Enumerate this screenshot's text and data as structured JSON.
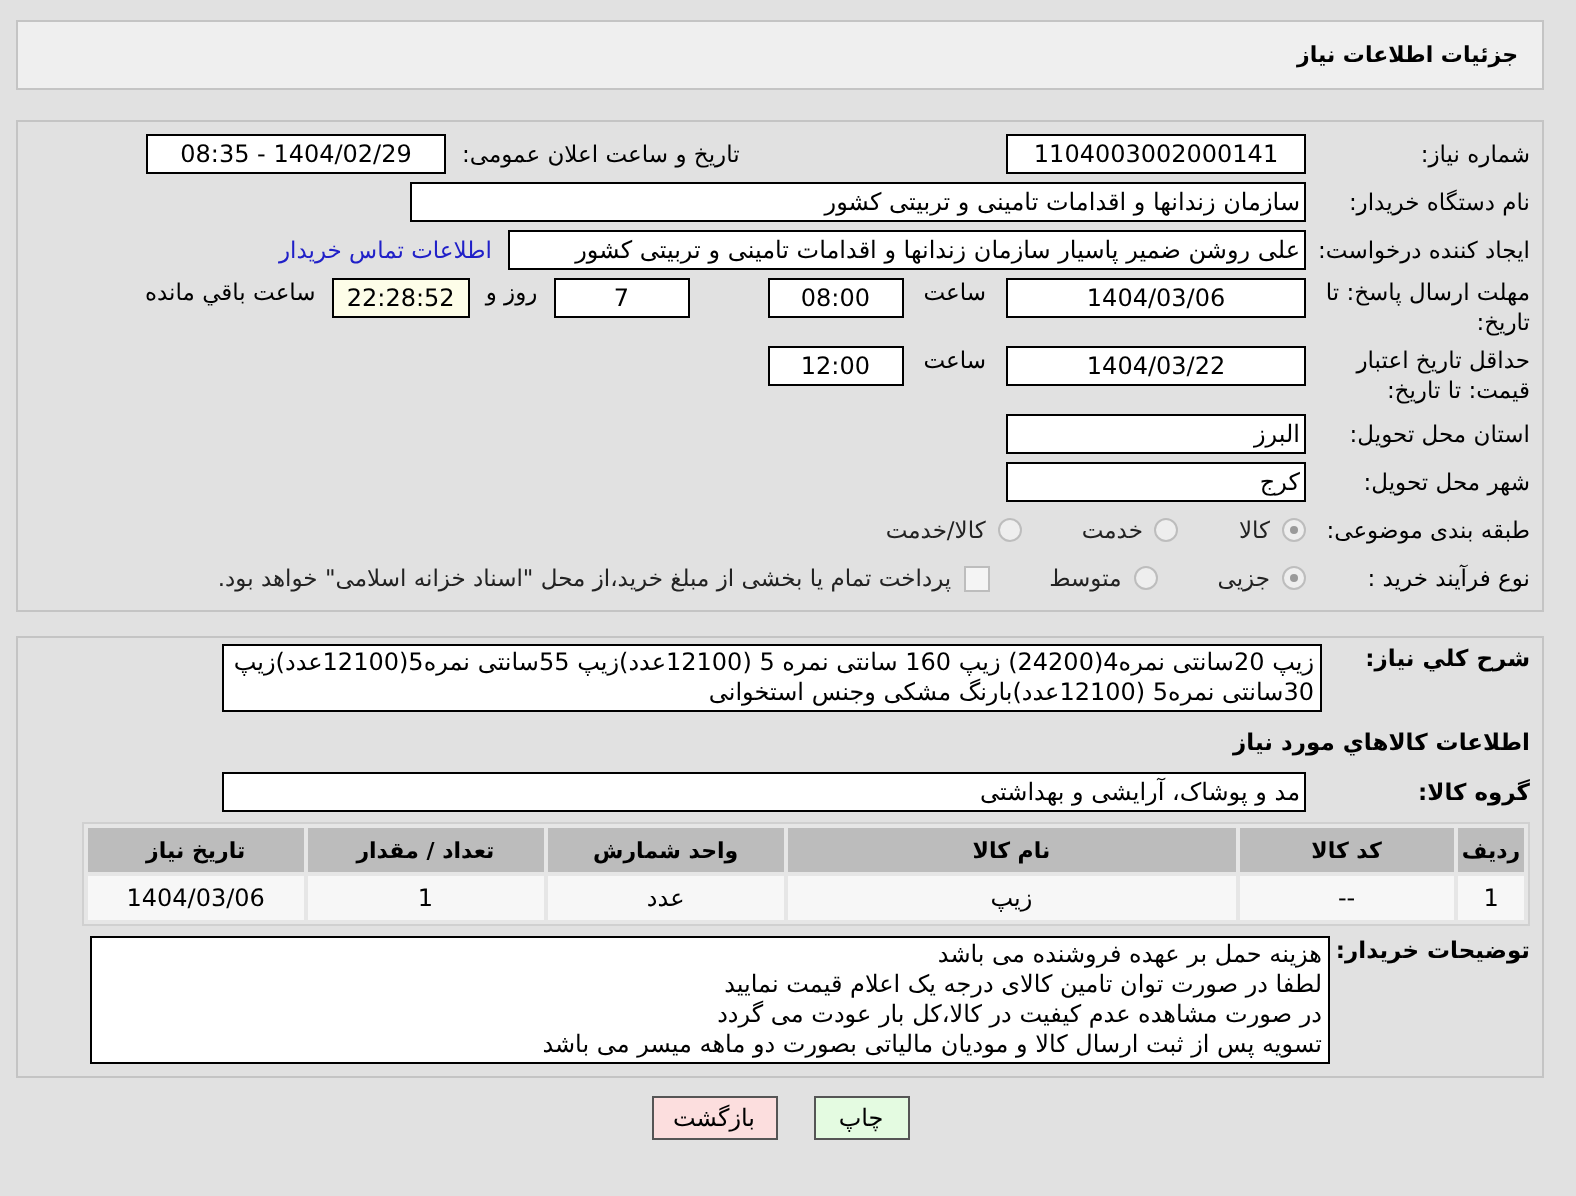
{
  "header": {
    "title": "جزئیات اطلاعات نیاز"
  },
  "need_number": {
    "label": "شماره نیاز:",
    "value": "1104003002000141"
  },
  "announce": {
    "label": "تاریخ و ساعت اعلان عمومی:",
    "value": "1404/02/29 - 08:35"
  },
  "buyer_org": {
    "label": "نام دستگاه خریدار:",
    "value": "سازمان زندانها و اقدامات تامینی و تربیتی کشور"
  },
  "requester": {
    "label": "ایجاد کننده درخواست:",
    "value": "علی روشن ضمیر پاسیار سازمان زندانها و اقدامات تامینی و تربیتی کشور",
    "link": "اطلاعات تماس خریدار"
  },
  "deadline": {
    "label": "مهلت ارسال پاسخ: تا تاریخ:",
    "date": "1404/03/06",
    "time_label": "ساعت",
    "time": "08:00",
    "days": "7",
    "days_label": "روز و",
    "remaining": "22:28:52",
    "remaining_label": "ساعت باقي مانده"
  },
  "validity": {
    "label": "حداقل تاریخ اعتبار قیمت: تا تاریخ:",
    "date": "1404/03/22",
    "time_label": "ساعت",
    "time": "12:00"
  },
  "province": {
    "label": "استان محل تحویل:",
    "value": "البرز"
  },
  "city": {
    "label": "شهر محل تحویل:",
    "value": "کرج"
  },
  "category": {
    "label": "طبقه بندی موضوعی:",
    "options": [
      {
        "label": "کالا",
        "selected": true
      },
      {
        "label": "خدمت",
        "selected": false
      },
      {
        "label": "کالا/خدمت",
        "selected": false
      }
    ]
  },
  "process": {
    "label": "نوع فرآیند خرید :",
    "options": [
      {
        "label": "جزیی",
        "selected": true
      },
      {
        "label": "متوسط",
        "selected": false
      }
    ],
    "treasury": {
      "label": "پرداخت تمام یا بخشی از مبلغ خرید،از محل \"اسناد خزانه اسلامی\" خواهد بود.",
      "checked": false
    }
  },
  "description": {
    "label": "شرح کلي نياز:",
    "value": "زیپ 20سانتی نمره4(24200) زیپ 160 سانتی نمره 5 (12100عدد)زیپ 55سانتی نمره5(12100عدد)زیپ 30سانتی نمره5 (12100عدد)بارنگ مشکی وجنس استخوانی"
  },
  "goods_heading": "اطلاعات کالاهاي مورد نياز",
  "goods_group": {
    "label": "گروه کالا:",
    "value": "مد و پوشاک، آرایشی و بهداشتی"
  },
  "table": {
    "columns": [
      "ردیف",
      "کد کالا",
      "نام کالا",
      "واحد شمارش",
      "تعداد / مقدار",
      "تاریخ نیاز"
    ],
    "rows": [
      [
        "1",
        "--",
        "زیپ",
        "عدد",
        "1",
        "1404/03/06"
      ]
    ]
  },
  "buyer_notes": {
    "label": "توضیحات خریدار:",
    "lines": [
      "هزینه حمل بر عهده فروشنده می باشد",
      "لطفا در صورت توان تامین کالای درجه یک اعلام قیمت نمایید",
      "در صورت مشاهده عدم کیفیت در کالا،کل بار عودت می گردد",
      "تسویه پس از ثبت ارسال کالا و مودیان مالیاتی بصورت دو ماهه میسر می باشد"
    ]
  },
  "buttons": [
    {
      "label": "چاپ",
      "kind": "print"
    },
    {
      "label": "بازگشت",
      "kind": "back"
    }
  ]
}
